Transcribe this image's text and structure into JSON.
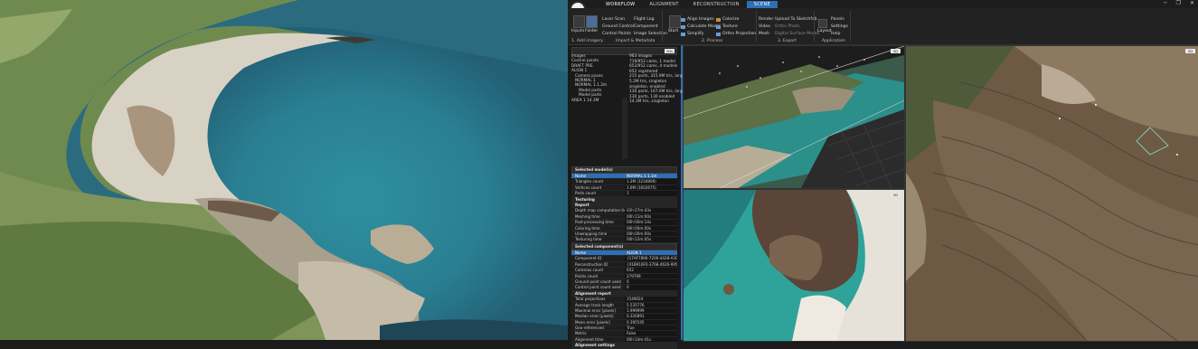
{
  "tabs": {
    "workflow": "WORKFLOW",
    "alignment": "ALIGNMENT",
    "reconstruction": "RECONSTRUCTION",
    "scene": "SCENE"
  },
  "ribbon": {
    "import": {
      "inputs": "Inputs",
      "folder": "Folder",
      "laser_scan": "Laser Scan",
      "ground_control": "Ground Control",
      "control_points": "Control Points",
      "flight_log": "Flight Log",
      "component": "Component",
      "image_selection": "Image Selection",
      "title": "1. Add imagery",
      "title2": "Import & Metadata"
    },
    "process": {
      "start": "Start",
      "align_images": "Align Images",
      "calculate_model": "Calculate Model",
      "simplify": "Simplify",
      "colorize": "Colorize",
      "texture": "Texture",
      "ortho_projection": "Ortho Projection",
      "title": "2. Process"
    },
    "export": {
      "render": "Render",
      "video": "Video",
      "mesh": "Mesh",
      "upload": "Upload To Sketchfab",
      "ortho_photo": "Ortho Photo",
      "dsm": "Digital Surface Model",
      "title": "3. Export"
    },
    "application": {
      "layout": "Layout",
      "panels": "Panels",
      "settings": "Settings",
      "help": "Help",
      "title": "Application"
    }
  },
  "tree": {
    "items": [
      "Images",
      "Control points",
      "DRAFT PRE",
      "ALIGN 1",
      "Camera poses",
      "NORMAL 1",
      "NORMAL 1.1.2m",
      "Model parts",
      "Model parts",
      "AREA 1 14.3M"
    ]
  },
  "info": {
    "items": [
      "963 images",
      "",
      "719/952 cams, 1 model",
      "652/952 cams, 4 models",
      "652 registered",
      "215 parts, 315.9M tris, large",
      "5.2M tris, singleton",
      "singleton, enabled",
      "130 parts, 167.0M tris, large",
      "130 parts, 130 enabled",
      "14.3M tris, singleton"
    ]
  },
  "selected_model": {
    "header": "Selected model(s)",
    "rows": [
      {
        "k": "Name",
        "v": "NORMAL 1 1.1m",
        "hl": true
      },
      {
        "k": "Triangles count",
        "v": "1.2M (1234806)"
      },
      {
        "k": "Vertices count",
        "v": "1.6M (1602675)"
      },
      {
        "k": "Parts count",
        "v": "1"
      },
      {
        "k": "Texturing",
        "v": "",
        "sec": true
      },
      {
        "k": "Report",
        "v": "",
        "sec": true
      },
      {
        "k": "Depth map computation time",
        "v": "02h:27m:43s"
      },
      {
        "k": "Meshing time",
        "v": "00h:11m:00s"
      },
      {
        "k": "Post-processing time",
        "v": "00h:00m:14s"
      },
      {
        "k": "Coloring time",
        "v": "00h:00m:00s"
      },
      {
        "k": "Unwrapping time",
        "v": "00h:00m:00s"
      },
      {
        "k": "Texturing time",
        "v": "00h:12m:05s"
      },
      {
        "k": "Overall processing time",
        "v": "00h:00m:00s"
      },
      {
        "k": "Settings",
        "v": "",
        "sec": true
      }
    ]
  },
  "selected_component": {
    "header": "Selected component(s)",
    "rows": [
      {
        "k": "Name",
        "v": "ALIGN 1",
        "hl": true
      },
      {
        "k": "Component ID",
        "v": "{17AF7896-7200-4428-A3CB-17..."
      },
      {
        "k": "Reconstruction ID",
        "v": "{41B910F0-3768-4626-9950-5..."
      },
      {
        "k": "Cameras count",
        "v": "652"
      },
      {
        "k": "Points count",
        "v": "279799"
      },
      {
        "k": "Ground point count used",
        "v": "0"
      },
      {
        "k": "Control point count used",
        "v": "0"
      },
      {
        "k": "Alignment report",
        "v": "",
        "sec": true
      },
      {
        "k": "Total projections",
        "v": "1549024"
      },
      {
        "k": "Average track length",
        "v": "5.535776"
      },
      {
        "k": "Maximal error [pixels]",
        "v": "1.999999"
      },
      {
        "k": "Median error [pixels]",
        "v": "0.326891"
      },
      {
        "k": "Mean error [pixels]",
        "v": "0.395545"
      },
      {
        "k": "Geo-referenced",
        "v": "True"
      },
      {
        "k": "Metric",
        "v": "False"
      },
      {
        "k": "Alignment time",
        "v": "00h:14m:41s"
      },
      {
        "k": "Alignment settings",
        "v": "",
        "sec": true
      }
    ]
  },
  "views": {
    "badge_a": "2D",
    "badge_b": "2D",
    "badge_c": "2D",
    "badge_top": "3D"
  },
  "colors": {
    "accent": "#2f6fb4",
    "panel": "#1a1a1a",
    "ribbon": "#222222"
  }
}
